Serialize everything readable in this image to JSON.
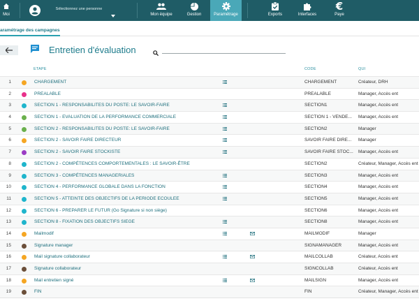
{
  "nav": {
    "moi": "Moi",
    "user_select": "Sélectionnez une personne",
    "items": [
      {
        "label": "Mon équipe",
        "icon": "team-icon"
      },
      {
        "label": "Gestion",
        "icon": "pie-chart-icon"
      },
      {
        "label": "Paramétrage",
        "icon": "gear-icon",
        "active": true
      },
      {
        "label": "Exports",
        "icon": "clipboard-check-icon"
      },
      {
        "label": "Interfaces",
        "icon": "puzzle-icon"
      },
      {
        "label": "Paye",
        "icon": "euro-icon"
      }
    ]
  },
  "breadcrumb": "aramétrage des campagnes",
  "page": {
    "title": "Entretien d'évaluation",
    "search_placeholder": ""
  },
  "columns": {
    "etape": "ETAPE",
    "code": "CODE",
    "qui": "QUI"
  },
  "colors": {
    "topbar": "#1f5c66",
    "active_tab": "#4aa8b8",
    "orange": "#f5a623",
    "pink": "#e8318a",
    "cyan": "#1fb5cc",
    "green": "#6ab04c",
    "purple": "#9b3cc4",
    "brown": "#6b4f3a"
  },
  "rows": [
    {
      "num": "1",
      "dot": "orange",
      "etape": "CHARGEMENT",
      "list": true,
      "mail": false,
      "code": "CHARGEMENT",
      "qui": "Créateur, DRH"
    },
    {
      "num": "2",
      "dot": "pink",
      "etape": "PREALABLE",
      "list": false,
      "mail": false,
      "code": "PREALABLE",
      "qui": "Manager, Accès ent"
    },
    {
      "num": "3",
      "dot": "cyan",
      "etape": "SECTION 1 - RESPONSABILITES DU POSTE: LE SAVOIR-FAIRE",
      "list": true,
      "mail": false,
      "code": "SECTION1",
      "qui": "Manager, Accès ent"
    },
    {
      "num": "4",
      "dot": "green",
      "etape": "SECTION 1 - EVALUATION DE LA PERFORMANCE COMMERCIALE",
      "list": true,
      "mail": false,
      "code": "SECTION 1 - VENDE...",
      "qui": "Manager, Accès ent"
    },
    {
      "num": "5",
      "dot": "green",
      "etape": "SECTION 2 - RESPONSABILITES DU POSTE: LE SAVOIR-FAIRE",
      "list": true,
      "mail": false,
      "code": "SECTION2",
      "qui": "Manager"
    },
    {
      "num": "6",
      "dot": "orange",
      "etape": "SECTION 2 - SAVOIR FAIRE DIRECTEUR",
      "list": true,
      "mail": false,
      "code": "SAVOIR FAIRE DIRE...",
      "qui": "Manager"
    },
    {
      "num": "7",
      "dot": "purple",
      "etape": "SECTION 2 - SAVOIR FAIRE STOCKISTE",
      "list": true,
      "mail": false,
      "code": "SAVOIR FAIRE STOC...",
      "qui": "Manager, Accès ent"
    },
    {
      "num": "8",
      "dot": "cyan",
      "etape": "SECTION 2 - COMPÉTENCES COMPORTEMENTALES : LE SAVOIR-ÊTRE",
      "list": false,
      "mail": false,
      "code": "SECTION2",
      "qui": "Créateur, Manager, Accès ent"
    },
    {
      "num": "9",
      "dot": "cyan",
      "etape": "SECTION 3 - COMPÉTENCES MANAGERIALES",
      "list": true,
      "mail": false,
      "code": "SECTION3",
      "qui": "Manager, Accès ent"
    },
    {
      "num": "10",
      "dot": "cyan",
      "etape": "SECTION 4 - PERFORMANCE GLOBALE DANS LA FONCTION",
      "list": true,
      "mail": false,
      "code": "SECTION4",
      "qui": "Manager, Accès ent"
    },
    {
      "num": "11",
      "dot": "cyan",
      "etape": "SECTION 5 - ATTEINTE DES OBJECTIFS DE LA PERIODE ECOULEE",
      "list": true,
      "mail": false,
      "code": "SECTION5",
      "qui": "Manager, Accès ent"
    },
    {
      "num": "12",
      "dot": "cyan",
      "etape": "SECTION 6 - PREPARER LE FUTUR (Go Signature si non siège)",
      "list": false,
      "mail": false,
      "code": "SECTION6",
      "qui": "Manager, Accès ent"
    },
    {
      "num": "13",
      "dot": "cyan",
      "etape": "SECTION 8 - FIXATION DES OBJECTIFS SIEGE",
      "list": true,
      "mail": false,
      "code": "SECTION8",
      "qui": "Manager, Accès ent"
    },
    {
      "num": "14",
      "dot": "orange",
      "etape": "Mailmodif",
      "list": true,
      "mail": true,
      "code": "MAILMODIF",
      "qui": "Manager"
    },
    {
      "num": "15",
      "dot": "brown",
      "etape": "Signature manager",
      "list": false,
      "mail": false,
      "code": "SIGNAMANAGER",
      "qui": "Manager, Accès ent"
    },
    {
      "num": "16",
      "dot": "orange",
      "etape": "Mail signature collaborateur",
      "list": true,
      "mail": true,
      "code": "MAILCOLLAB",
      "qui": "Créateur, Accès ent"
    },
    {
      "num": "17",
      "dot": "brown",
      "etape": "Signature collaborateur",
      "list": false,
      "mail": false,
      "code": "SIGNCOLLAB",
      "qui": "Créateur, Accès ent"
    },
    {
      "num": "18",
      "dot": "orange",
      "etape": "Mail entretien signé",
      "list": true,
      "mail": true,
      "code": "MAILSIGN",
      "qui": "Manager, Accès ent"
    },
    {
      "num": "19",
      "dot": "brown",
      "etape": "FIN",
      "list": false,
      "mail": false,
      "code": "FIN",
      "qui": "Créateur, Manager, Accès ent"
    }
  ]
}
